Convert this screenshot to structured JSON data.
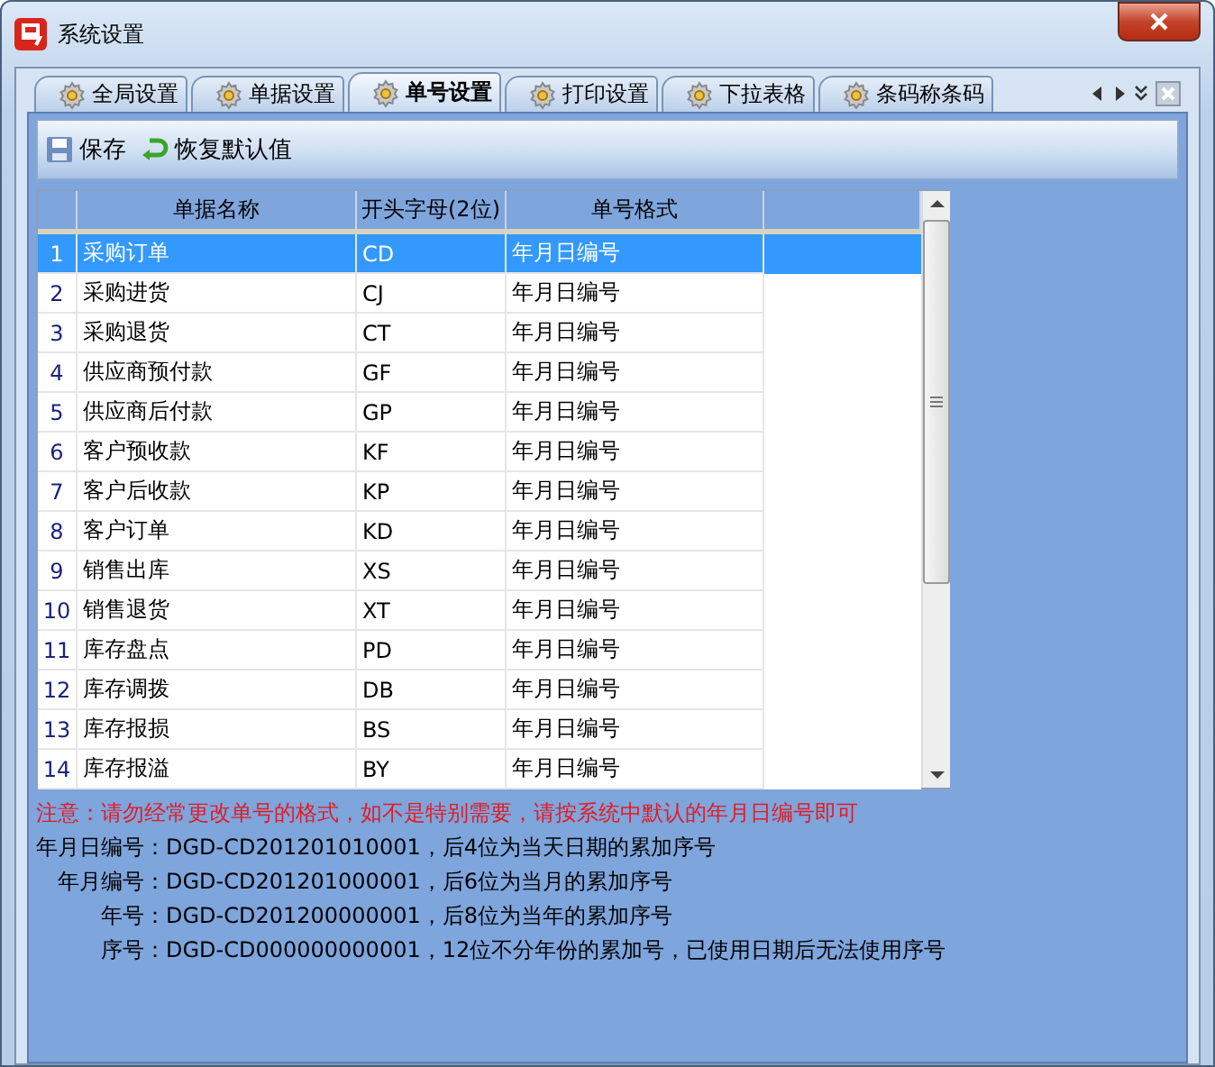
{
  "window": {
    "title": "系统设置"
  },
  "tabs": [
    {
      "label": "全局设置",
      "selected": false
    },
    {
      "label": "单据设置",
      "selected": false
    },
    {
      "label": "单号设置",
      "selected": true
    },
    {
      "label": "打印设置",
      "selected": false
    },
    {
      "label": "下拉表格",
      "selected": false
    },
    {
      "label": "条码称条码",
      "selected": false
    }
  ],
  "toolbar": [
    {
      "kind": "save",
      "label": "保存"
    },
    {
      "kind": "restore",
      "label": "恢复默认值"
    }
  ],
  "table": {
    "columns": [
      "单据名称",
      "开头字母(2位)",
      "单号格式"
    ],
    "rows": [
      {
        "number": "1",
        "name": "采购订单",
        "prefix": "CD",
        "format": "年月日编号",
        "selected": true
      },
      {
        "number": "2",
        "name": "采购进货",
        "prefix": "CJ",
        "format": "年月日编号",
        "selected": false
      },
      {
        "number": "3",
        "name": "采购退货",
        "prefix": "CT",
        "format": "年月日编号",
        "selected": false
      },
      {
        "number": "4",
        "name": "供应商预付款",
        "prefix": "GF",
        "format": "年月日编号",
        "selected": false
      },
      {
        "number": "5",
        "name": "供应商后付款",
        "prefix": "GP",
        "format": "年月日编号",
        "selected": false
      },
      {
        "number": "6",
        "name": "客户预收款",
        "prefix": "KF",
        "format": "年月日编号",
        "selected": false
      },
      {
        "number": "7",
        "name": "客户后收款",
        "prefix": "KP",
        "format": "年月日编号",
        "selected": false
      },
      {
        "number": "8",
        "name": "客户订单",
        "prefix": "KD",
        "format": "年月日编号",
        "selected": false
      },
      {
        "number": "9",
        "name": "销售出库",
        "prefix": "XS",
        "format": "年月日编号",
        "selected": false
      },
      {
        "number": "10",
        "name": "销售退货",
        "prefix": "XT",
        "format": "年月日编号",
        "selected": false
      },
      {
        "number": "11",
        "name": "库存盘点",
        "prefix": "PD",
        "format": "年月日编号",
        "selected": false
      },
      {
        "number": "12",
        "name": "库存调拨",
        "prefix": "DB",
        "format": "年月日编号",
        "selected": false
      },
      {
        "number": "13",
        "name": "库存报损",
        "prefix": "BS",
        "format": "年月日编号",
        "selected": false
      },
      {
        "number": "14",
        "name": "库存报溢",
        "prefix": "BY",
        "format": "年月日编号",
        "selected": false
      }
    ]
  },
  "warning": "注意：请勿经常更改单号的格式，如不是特别需要，请按系统中默认的年月日编号即可",
  "notes": [
    {
      "label": "年月日编号：",
      "text": "DGD-CD201201010001，后4位为当天日期的累加序号"
    },
    {
      "label": "年月编号：",
      "text": "DGD-CD201201000001，后6位为当月的累加序号"
    },
    {
      "label": "年号：",
      "text": "DGD-CD201200000001，后8位为当年的累加序号"
    },
    {
      "label": "序号：",
      "text": "DGD-CD000000000001，12位不分年份的累加号，已使用日期后无法使用序号"
    }
  ]
}
